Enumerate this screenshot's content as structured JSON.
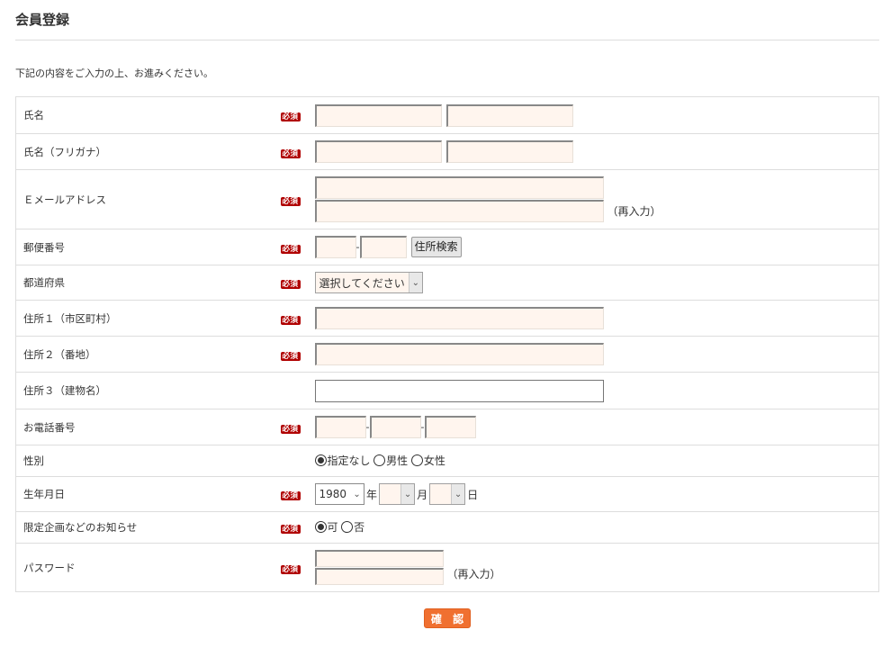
{
  "title": "会員登録",
  "intro": "下記の内容をご入力の上、お進みください。",
  "required_label": "必須",
  "fields": {
    "name": {
      "label": "氏名"
    },
    "kana": {
      "label": "氏名（フリガナ）"
    },
    "email": {
      "label": "Ｅメールアドレス",
      "reenter": "（再入力）"
    },
    "zip": {
      "label": "郵便番号",
      "dash": "-",
      "search_button": "住所検索"
    },
    "pref": {
      "label": "都道府県",
      "selected": "選択してください"
    },
    "addr1": {
      "label": "住所１（市区町村）"
    },
    "addr2": {
      "label": "住所２（番地）"
    },
    "addr3": {
      "label": "住所３（建物名）"
    },
    "phone": {
      "label": "お電話番号",
      "dash": "-"
    },
    "gender": {
      "label": "性別",
      "options": [
        "指定なし",
        "男性",
        "女性"
      ],
      "selected": "指定なし"
    },
    "birth": {
      "label": "生年月日",
      "year": "1980",
      "year_unit": "年",
      "month": "",
      "month_unit": "月",
      "day": "",
      "day_unit": "日"
    },
    "news": {
      "label": "限定企画などのお知らせ",
      "options": [
        "可",
        "否"
      ],
      "selected": "可"
    },
    "password": {
      "label": "パスワード",
      "reenter": "（再入力）"
    }
  },
  "submit_label": "確 認",
  "icons": {
    "dropdown": "chevron-down-icon",
    "radio": "radio-icon"
  },
  "colors": {
    "required_badge": "#b00000",
    "input_bg": "#fff5ee",
    "submit": "#f07030"
  }
}
